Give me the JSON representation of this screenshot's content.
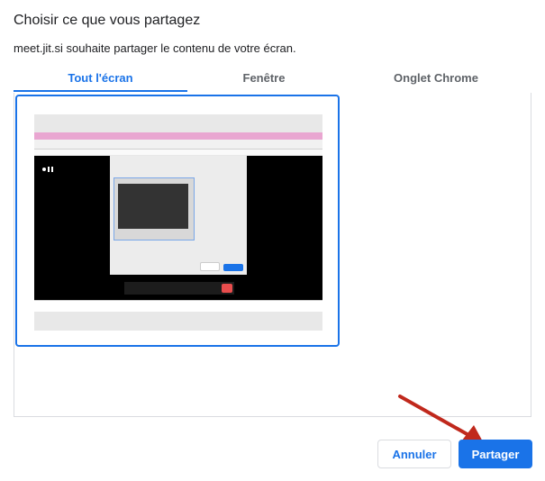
{
  "dialog": {
    "title": "Choisir ce que vous partagez",
    "subtitle": "meet.jit.si souhaite partager le contenu de votre écran."
  },
  "tabs": [
    {
      "label": "Tout l'écran",
      "active": true
    },
    {
      "label": "Fenêtre",
      "active": false
    },
    {
      "label": "Onglet Chrome",
      "active": false
    }
  ],
  "buttons": {
    "cancel_label": "Annuler",
    "share_label": "Partager"
  },
  "colors": {
    "accent": "#1a73e8",
    "arrow": "#c0281c"
  }
}
